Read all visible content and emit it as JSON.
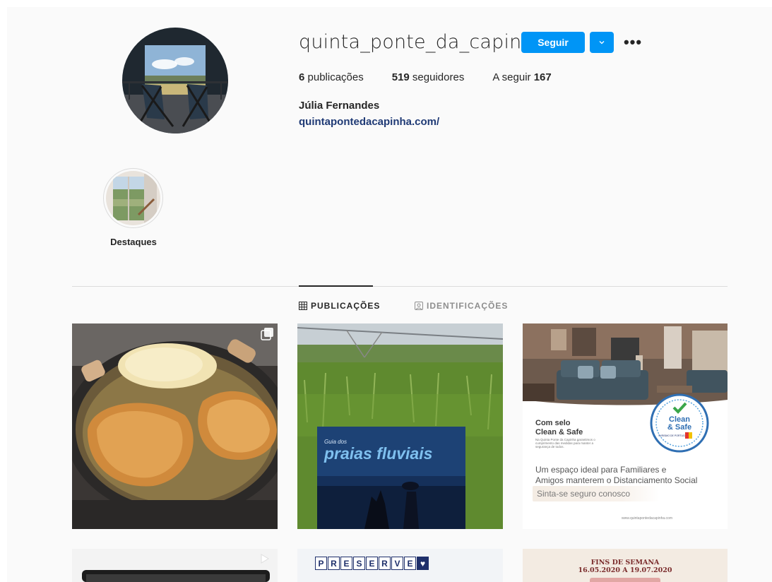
{
  "profile": {
    "username": "quinta_ponte_da_capinha",
    "follow_label": "Seguir",
    "more_label": "•••",
    "stats": {
      "posts_count": "6",
      "posts_label": " publicações",
      "followers_count": "519",
      "followers_label": " seguidores",
      "following_label": "A seguir ",
      "following_count": "167"
    },
    "full_name": "Júlia Fernandes",
    "website": "quintapontedacapinha.com/"
  },
  "highlights": [
    {
      "label": "Destaques"
    }
  ],
  "tabs": [
    {
      "label": "PUBLICAÇÕES",
      "active": true
    },
    {
      "label": "IDENTIFICAÇÕES",
      "active": false
    }
  ],
  "posts": {
    "clean_safe": {
      "title_line1": "Com selo",
      "title_line2": "Clean & Safe",
      "small_text": "Na Quinta Ponte da Capinha garantimos o cumprimento das medidas para manter a segurança de todos.",
      "badge_line1": "Clean",
      "badge_line2": "& Safe",
      "badge_small": "TURISMO DE PORTUGAL",
      "desc_line1": "Um espaço ideal para Familiares e",
      "desc_line2": "Amigos manterem o Distanciamento Social",
      "cta": "Sinta-se seguro conosco",
      "footer": "www.quintapontedacapinha.com"
    },
    "praias": {
      "small": "Guia dos",
      "title": "praias fluviais"
    },
    "preserve": {
      "letters": [
        "P",
        "R",
        "E",
        "S",
        "E",
        "R",
        "V",
        "E",
        "♥"
      ]
    },
    "fins": {
      "line1": "FINS DE SEMANA",
      "line2": "16.05.2020 A 19.07.2020"
    }
  },
  "colors": {
    "accent": "#0095f6",
    "link": "#1f3a75"
  }
}
